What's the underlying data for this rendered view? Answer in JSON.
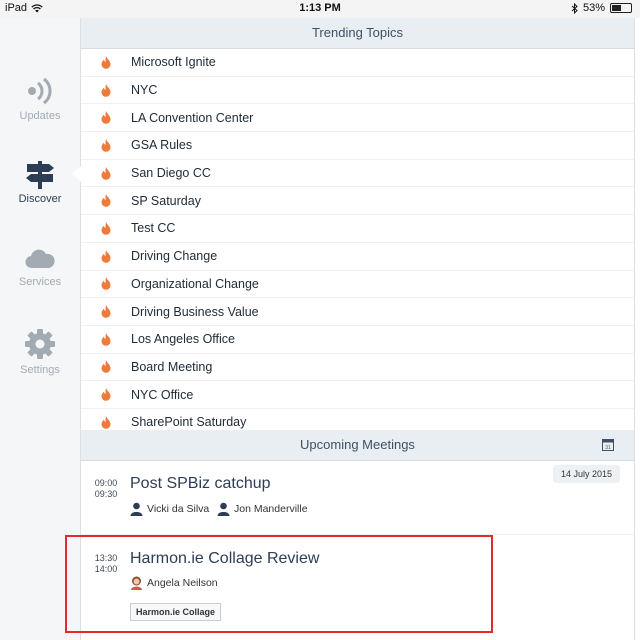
{
  "status_bar": {
    "device": "iPad",
    "time": "1:13 PM",
    "battery": "53%",
    "battery_level": 0.53
  },
  "sidebar": {
    "items": [
      {
        "label": "Updates",
        "icon": "broadcast-icon"
      },
      {
        "label": "Discover",
        "icon": "signpost-icon",
        "active": true
      },
      {
        "label": "Services",
        "icon": "cloud-icon"
      },
      {
        "label": "Settings",
        "icon": "gear-icon"
      }
    ]
  },
  "trending": {
    "header": "Trending Topics",
    "topics": [
      "Microsoft Ignite",
      "NYC",
      "LA Convention Center",
      "GSA Rules",
      "San Diego CC",
      "SP Saturday",
      "Test CC",
      "Driving Change",
      "Organizational Change",
      "Driving Business Value",
      "Los Angeles Office",
      "Board Meeting",
      "NYC Office",
      "SharePoint Saturday"
    ]
  },
  "meetings": {
    "header": "Upcoming Meetings",
    "date": "14 July 2015",
    "items": [
      {
        "start": "09:00",
        "end": "09:30",
        "title": "Post SPBiz catchup",
        "attendees": [
          "Vicki da Silva",
          "Jon Manderville"
        ]
      },
      {
        "start": "13:30",
        "end": "14:00",
        "title": "Harmon.ie Collage Review",
        "attendees": [
          "Angela Neilson"
        ],
        "tag": "Harmon.ie Collage"
      }
    ]
  },
  "colors": {
    "accent": "#2c3e55",
    "flame": "#f07a3a",
    "highlight": "#e02b2b",
    "header_bg": "#e9eef2"
  }
}
